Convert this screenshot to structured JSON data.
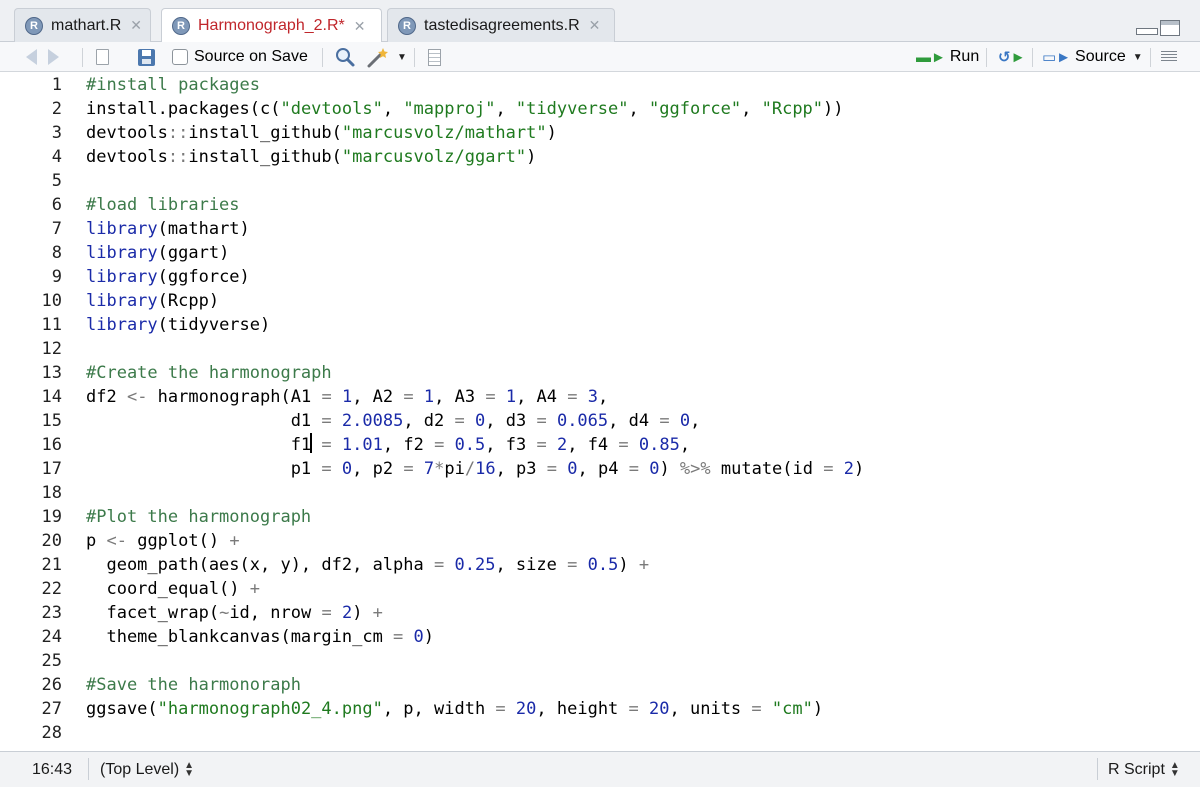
{
  "tabs": [
    {
      "label": "mathart.R",
      "icon": "r-file-icon",
      "active": false
    },
    {
      "label": "Harmonograph_2.R*",
      "icon": "r-file-icon",
      "active": true
    },
    {
      "label": "tastedisagreements.R",
      "icon": "r-file-icon",
      "active": false
    }
  ],
  "toolbar": {
    "source_on_save_label": "Source on Save",
    "source_on_save_checked": false,
    "run_label": "Run",
    "source_label": "Source"
  },
  "editor": {
    "lines": [
      "#install packages",
      "install.packages(c(\"devtools\", \"mapproj\", \"tidyverse\", \"ggforce\", \"Rcpp\"))",
      "devtools::install_github(\"marcusvolz/mathart\")",
      "devtools::install_github(\"marcusvolz/ggart\")",
      "",
      "#load libraries",
      "library(mathart)",
      "library(ggart)",
      "library(ggforce)",
      "library(Rcpp)",
      "library(tidyverse)",
      "",
      "#Create the harmonograph",
      "df2 <- harmonograph(A1 = 1, A2 = 1, A3 = 1, A4 = 3,",
      "                    d1 = 2.0085, d2 = 0, d3 = 0.065, d4 = 0,",
      "                    f1 = 1.01, f2 = 0.5, f3 = 2, f4 = 0.85,",
      "                    p1 = 0, p2 = 7*pi/16, p3 = 0, p4 = 0) %>% mutate(id = 2)",
      "",
      "#Plot the harmonograph",
      "p <- ggplot() +",
      "  geom_path(aes(x, y), df2, alpha = 0.25, size = 0.5) +",
      "  coord_equal() +",
      "  facet_wrap(~id, nrow = 2) +",
      "  theme_blankcanvas(margin_cm = 0)",
      "",
      "#Save the harmonoraph",
      "ggsave(\"harmonograph02_4.png\", p, width = 20, height = 20, units = \"cm\")",
      ""
    ],
    "cursor": {
      "line": 16,
      "column": 23
    }
  },
  "status": {
    "position": "16:43",
    "scope": "(Top Level)",
    "file_type": "R Script"
  },
  "colors": {
    "comment": "#3c7a4a",
    "string": "#1f7a1f",
    "number": "#1a2aa8",
    "function": "#1a2aa8",
    "operator": "#7a7a7a",
    "active_tab_text": "#c0262b"
  }
}
